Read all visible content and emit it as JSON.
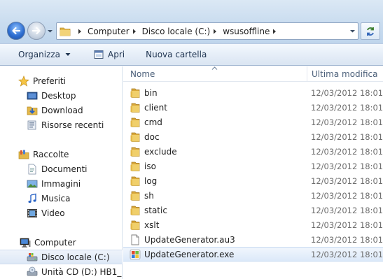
{
  "address": {
    "breadcrumbs": [
      "Computer",
      "Disco locale (C:)",
      "wsusoffline"
    ]
  },
  "toolbar": {
    "organize_label": "Organizza",
    "open_label": "Apri",
    "new_folder_label": "Nuova cartella"
  },
  "nav": {
    "items": [
      {
        "label": "Preferiti",
        "icon": "star-icon"
      },
      {
        "label": "Desktop",
        "icon": "desktop-icon"
      },
      {
        "label": "Download",
        "icon": "download-folder-icon"
      },
      {
        "label": "Risorse recenti",
        "icon": "recent-places-icon"
      },
      {
        "label": "Raccolte",
        "icon": "libraries-icon"
      },
      {
        "label": "Documenti",
        "icon": "documents-icon"
      },
      {
        "label": "Immagini",
        "icon": "pictures-icon"
      },
      {
        "label": "Musica",
        "icon": "music-icon"
      },
      {
        "label": "Video",
        "icon": "video-icon"
      },
      {
        "label": "Computer",
        "icon": "computer-icon"
      },
      {
        "label": "Disco locale (C:)",
        "icon": "local-disk-icon"
      },
      {
        "label": "Unità CD (D:) HB1_",
        "icon": "cd-drive-icon"
      }
    ]
  },
  "columns": {
    "name": "Nome",
    "modified": "Ultima modifica"
  },
  "files": [
    {
      "name": "bin",
      "modified": "12/03/2012 18:01",
      "type": "folder"
    },
    {
      "name": "client",
      "modified": "12/03/2012 18:01",
      "type": "folder"
    },
    {
      "name": "cmd",
      "modified": "12/03/2012 18:01",
      "type": "folder"
    },
    {
      "name": "doc",
      "modified": "12/03/2012 18:01",
      "type": "folder"
    },
    {
      "name": "exclude",
      "modified": "12/03/2012 18:01",
      "type": "folder"
    },
    {
      "name": "iso",
      "modified": "12/03/2012 18:01",
      "type": "folder"
    },
    {
      "name": "log",
      "modified": "12/03/2012 18:01",
      "type": "folder"
    },
    {
      "name": "sh",
      "modified": "12/03/2012 18:01",
      "type": "folder"
    },
    {
      "name": "static",
      "modified": "12/03/2012 18:01",
      "type": "folder"
    },
    {
      "name": "xslt",
      "modified": "12/03/2012 18:01",
      "type": "folder"
    },
    {
      "name": "UpdateGenerator.au3",
      "modified": "12/03/2012 18:01",
      "type": "file"
    },
    {
      "name": "UpdateGenerator.exe",
      "modified": "12/03/2012 18:01",
      "type": "exe"
    }
  ],
  "colors": {
    "accent": "#3c6fb3",
    "selection": "#dce9f9",
    "folder": "#e8c45a"
  }
}
